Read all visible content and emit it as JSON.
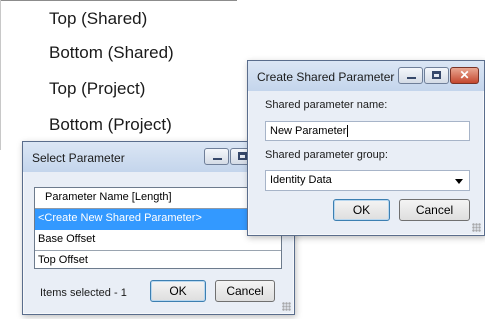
{
  "menu": {
    "items": [
      "Top (Shared)",
      "Bottom (Shared)",
      "Top (Project)",
      "Bottom (Project)"
    ]
  },
  "select_parameter": {
    "title": "Select Parameter",
    "column_header": "Parameter Name [Length]",
    "rows": [
      "<Create New Shared Parameter>",
      "Base Offset",
      "Top Offset"
    ],
    "selected_row": 0,
    "status": "Items selected - 1",
    "ok_label": "OK",
    "cancel_label": "Cancel"
  },
  "create_shared_parameter": {
    "title": "Create Shared Parameter",
    "name_label": "Shared parameter name:",
    "name_value": "New Parameter",
    "group_label": "Shared parameter group:",
    "group_value": "Identity Data",
    "ok_label": "OK",
    "cancel_label": "Cancel"
  },
  "colors": {
    "selection": "#3399ff",
    "titlebar": "#c4d5ec",
    "close_button": "#c4472e"
  },
  "icons": [
    "minimize-icon",
    "maximize-icon",
    "close-icon",
    "dropdown-arrow-icon",
    "resize-grip-icon"
  ]
}
